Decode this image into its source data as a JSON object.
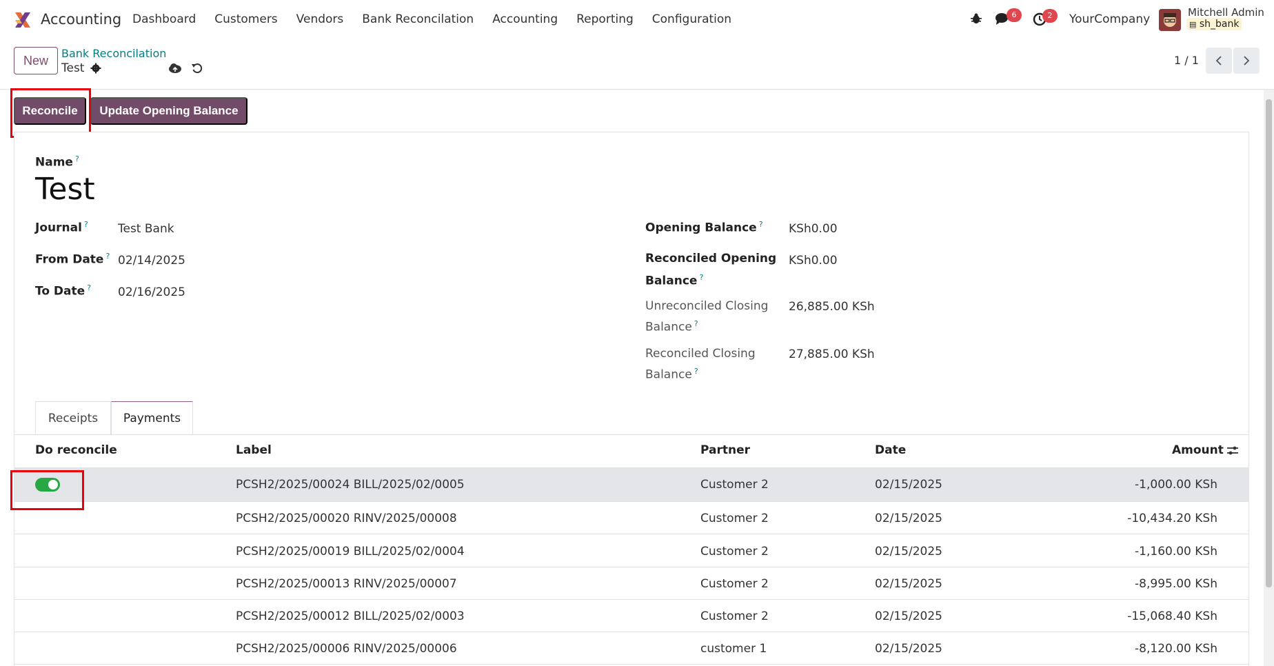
{
  "navbar": {
    "app_name": "Accounting",
    "menu": [
      "Dashboard",
      "Customers",
      "Vendors",
      "Bank Reconcilation",
      "Accounting",
      "Reporting",
      "Configuration"
    ],
    "messages_count": "6",
    "activities_count": "2",
    "company": "YourCompany",
    "user_name": "Mitchell Admin",
    "user_db": "sh_bank"
  },
  "control_panel": {
    "new_label": "New",
    "breadcrumb_parent": "Bank Reconcilation",
    "breadcrumb_current": "Test",
    "pager": "1 / 1"
  },
  "actions": {
    "reconcile_label": "Reconcile",
    "update_opening_label": "Update Opening Balance"
  },
  "form": {
    "name_label": "Name",
    "name_value": "Test",
    "journal_label": "Journal",
    "journal_value": "Test Bank",
    "from_date_label": "From Date",
    "from_date_value": "02/14/2025",
    "to_date_label": "To Date",
    "to_date_value": "02/16/2025",
    "opening_balance_label": "Opening Balance",
    "opening_balance_value": "KSh0.00",
    "rec_opening_label_1": "Reconciled Opening",
    "rec_opening_label_2": "Balance",
    "rec_opening_value": "KSh0.00",
    "unrec_closing_label_1": "Unreconciled Closing",
    "unrec_closing_label_2": "Balance",
    "unrec_closing_value": "26,885.00 KSh",
    "rec_closing_label_1": "Reconciled Closing",
    "rec_closing_label_2": "Balance",
    "rec_closing_value": "27,885.00 KSh"
  },
  "tabs": [
    "Receipts",
    "Payments"
  ],
  "table": {
    "headers": {
      "do_reconcile": "Do reconcile",
      "label": "Label",
      "partner": "Partner",
      "date": "Date",
      "amount": "Amount"
    },
    "rows": [
      {
        "toggle": true,
        "label": "PCSH2/2025/00024 BILL/2025/02/0005",
        "partner": "Customer 2",
        "date": "02/15/2025",
        "amount": "-1,000.00 KSh"
      },
      {
        "toggle": false,
        "label": "PCSH2/2025/00020 RINV/2025/00008",
        "partner": "Customer 2",
        "date": "02/15/2025",
        "amount": "-10,434.20 KSh"
      },
      {
        "toggle": false,
        "label": "PCSH2/2025/00019 BILL/2025/02/0004",
        "partner": "Customer 2",
        "date": "02/15/2025",
        "amount": "-1,160.00 KSh"
      },
      {
        "toggle": false,
        "label": "PCSH2/2025/00013 RINV/2025/00007",
        "partner": "Customer 2",
        "date": "02/15/2025",
        "amount": "-8,995.00 KSh"
      },
      {
        "toggle": false,
        "label": "PCSH2/2025/00012 BILL/2025/02/0003",
        "partner": "Customer 2",
        "date": "02/15/2025",
        "amount": "-15,068.40 KSh"
      },
      {
        "toggle": false,
        "label": "PCSH2/2025/00006 RINV/2025/00006",
        "partner": "customer 1",
        "date": "02/15/2025",
        "amount": "-8,120.00 KSh"
      }
    ]
  },
  "colors": {
    "primary": "#714b67",
    "link": "#017e84",
    "toggle_on": "#28a745",
    "highlight": "#e8000b"
  }
}
